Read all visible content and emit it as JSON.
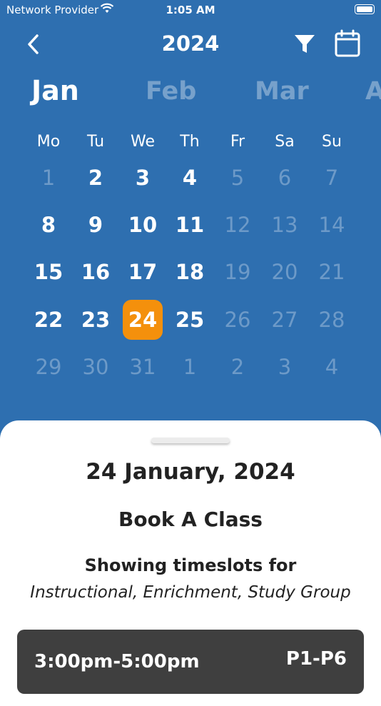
{
  "status_bar": {
    "carrier": "Network Provider",
    "time": "1:05 AM"
  },
  "nav": {
    "title": "2024",
    "back_icon": "chevron-left-icon",
    "filter_icon": "filter-icon",
    "calendar_icon": "calendar-icon"
  },
  "months": [
    "Jan",
    "Feb",
    "Mar",
    "A"
  ],
  "weekdays": [
    "Mo",
    "Tu",
    "We",
    "Th",
    "Fr",
    "Sa",
    "Su"
  ],
  "weeks": [
    [
      "1",
      "2",
      "3",
      "4",
      "5",
      "6",
      "7"
    ],
    [
      "8",
      "9",
      "10",
      "11",
      "12",
      "13",
      "14"
    ],
    [
      "15",
      "16",
      "17",
      "18",
      "19",
      "20",
      "21"
    ],
    [
      "22",
      "23",
      "24",
      "25",
      "26",
      "27",
      "28"
    ],
    [
      "29",
      "30",
      "31",
      "1",
      "2",
      "3",
      "4"
    ]
  ],
  "selected_day": "24",
  "sheet": {
    "date_heading": "24 January, 2024",
    "book_heading": "Book A Class",
    "showing_label": "Showing timeslots for",
    "types": "Instructional, Enrichment, Study Group",
    "slot": {
      "time_range": "3:00pm-5:00pm",
      "level": "P1-P6"
    }
  },
  "colors": {
    "background": "#2E6FB0",
    "selected": "#F4900C",
    "slot_bg": "#3F3F3F"
  }
}
